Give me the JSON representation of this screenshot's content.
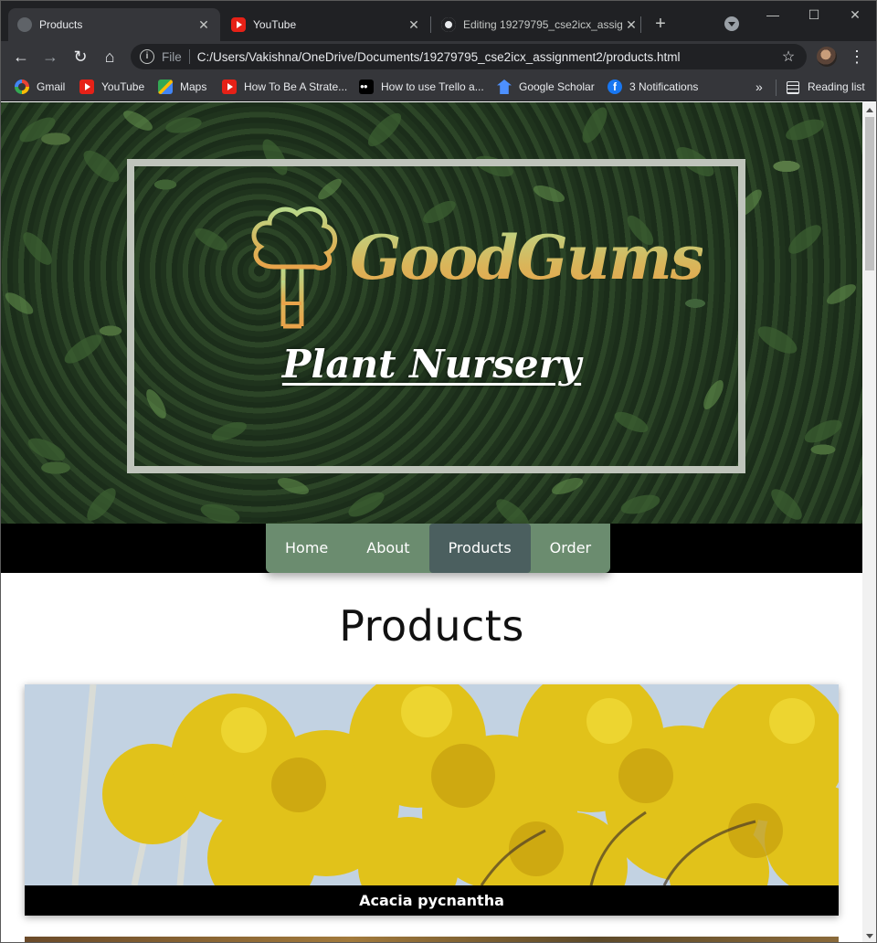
{
  "browser": {
    "tabs": [
      {
        "title": "Products",
        "active": true,
        "icon": "globe-icon"
      },
      {
        "title": "YouTube",
        "active": false,
        "icon": "youtube-icon"
      },
      {
        "title": "Editing 19279795_cse2icx_assig",
        "active": false,
        "icon": "github-icon"
      }
    ],
    "address": {
      "scheme": "File",
      "url": "C:/Users/Vakishna/OneDrive/Documents/19279795_cse2icx_assignment2/products.html"
    },
    "bookmarks": [
      {
        "label": "Gmail",
        "icon": "gmail-icon"
      },
      {
        "label": "YouTube",
        "icon": "youtube-icon"
      },
      {
        "label": "Maps",
        "icon": "maps-icon"
      },
      {
        "label": "How To Be A Strate...",
        "icon": "youtube-icon"
      },
      {
        "label": "How to use Trello a...",
        "icon": "medium-icon"
      },
      {
        "label": "Google Scholar",
        "icon": "scholar-icon"
      },
      {
        "label": "3 Notifications",
        "icon": "facebook-icon"
      }
    ],
    "reading_list": "Reading list",
    "more_bookmarks": "»"
  },
  "site": {
    "brand": "GoodGums",
    "subtitle": "Plant Nursery",
    "nav": [
      {
        "label": "Home",
        "active": false
      },
      {
        "label": "About",
        "active": false
      },
      {
        "label": "Products",
        "active": true
      },
      {
        "label": "Order",
        "active": false
      }
    ],
    "page_title": "Products",
    "products": [
      {
        "name": "Acacia pycnantha"
      }
    ]
  },
  "colors": {
    "nav_bg": "#6b8c6f",
    "nav_active": "#4b5f5f",
    "brand_gradient_top": "#b8d98a",
    "brand_gradient_bottom": "#e9a34a",
    "caption_bg": "#000000"
  }
}
